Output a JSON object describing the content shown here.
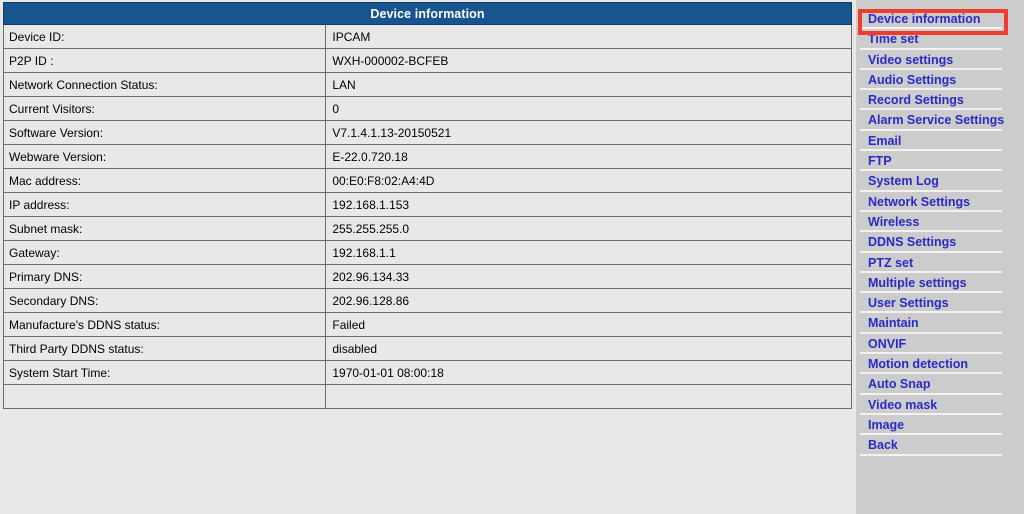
{
  "page": {
    "title": "Device information",
    "header_bg": "#17558f",
    "header_text_color": "#ffffff",
    "body_bg": "#e8e8e8",
    "sidebar_bg": "#cccccc",
    "link_color": "#2a2ac6",
    "highlight_color": "#f03c2e"
  },
  "table": {
    "title": "Device information",
    "rows": [
      {
        "label": "Device ID:",
        "value": "IPCAM"
      },
      {
        "label": "P2P ID :",
        "value": "WXH-000002-BCFEB"
      },
      {
        "label": "Network Connection Status:",
        "value": "LAN"
      },
      {
        "label": "Current Visitors:",
        "value": "0"
      },
      {
        "label": "Software Version:",
        "value": "V7.1.4.1.13-20150521"
      },
      {
        "label": "Webware Version:",
        "value": "E-22.0.720.18"
      },
      {
        "label": "Mac address:",
        "value": "00:E0:F8:02:A4:4D"
      },
      {
        "label": "IP address:",
        "value": "192.168.1.153"
      },
      {
        "label": "Subnet mask:",
        "value": "255.255.255.0"
      },
      {
        "label": "Gateway:",
        "value": "192.168.1.1"
      },
      {
        "label": "Primary DNS:",
        "value": "202.96.134.33"
      },
      {
        "label": "Secondary DNS:",
        "value": "202.96.128.86"
      },
      {
        "label": "Manufacture's DDNS status:",
        "value": "Failed"
      },
      {
        "label": "Third Party DDNS status:",
        "value": "disabled"
      },
      {
        "label": "System Start Time:",
        "value": "1970-01-01 08:00:18"
      },
      {
        "label": "",
        "value": ""
      }
    ]
  },
  "sidebar": {
    "active_index": 0,
    "items": [
      {
        "label": "Device information"
      },
      {
        "label": "Time set"
      },
      {
        "label": "Video settings"
      },
      {
        "label": "Audio Settings"
      },
      {
        "label": "Record Settings"
      },
      {
        "label": "Alarm Service Settings"
      },
      {
        "label": "Email"
      },
      {
        "label": "FTP"
      },
      {
        "label": "System Log"
      },
      {
        "label": "Network Settings"
      },
      {
        "label": "Wireless"
      },
      {
        "label": "DDNS Settings"
      },
      {
        "label": "PTZ set"
      },
      {
        "label": "Multiple settings"
      },
      {
        "label": "User Settings"
      },
      {
        "label": "Maintain"
      },
      {
        "label": "ONVIF"
      },
      {
        "label": "Motion detection"
      },
      {
        "label": "Auto Snap"
      },
      {
        "label": "Video mask"
      },
      {
        "label": "Image"
      },
      {
        "label": "Back"
      }
    ]
  }
}
